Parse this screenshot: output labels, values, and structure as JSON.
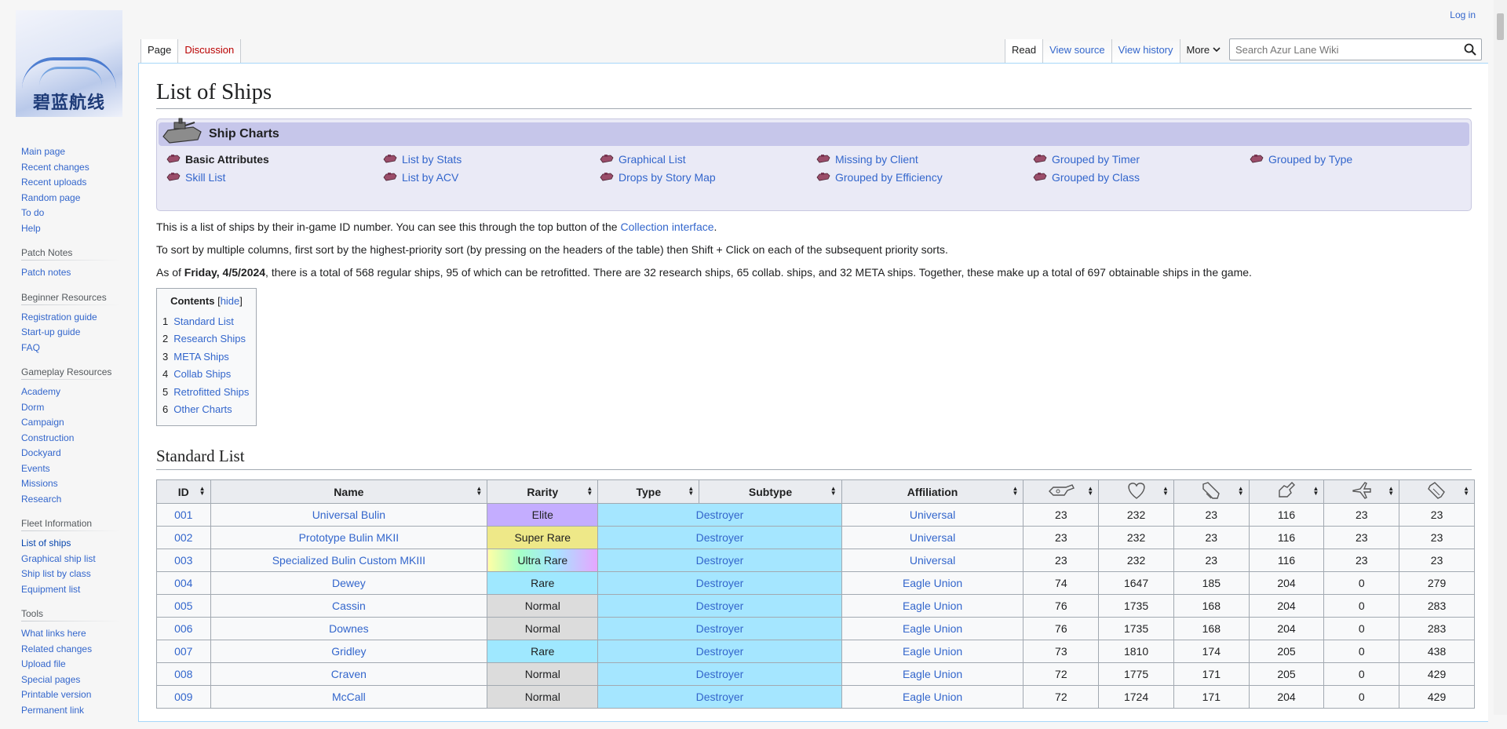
{
  "logo": {
    "text": "碧蓝航线"
  },
  "personal": {
    "login": "Log in"
  },
  "sidebar": {
    "nav": [
      "Main page",
      "Recent changes",
      "Recent uploads",
      "Random page",
      "To do",
      "Help"
    ],
    "sections": [
      {
        "heading": "Patch Notes",
        "items": [
          "Patch notes"
        ]
      },
      {
        "heading": "Beginner Resources",
        "items": [
          "Registration guide",
          "Start-up guide",
          "FAQ"
        ]
      },
      {
        "heading": "Gameplay Resources",
        "items": [
          "Academy",
          "Dorm",
          "Campaign",
          "Construction",
          "Dockyard",
          "Events",
          "Missions",
          "Research"
        ]
      },
      {
        "heading": "Fleet Information",
        "items": [
          "List of ships",
          "Graphical ship list",
          "Ship list by class",
          "Equipment list"
        ]
      },
      {
        "heading": "Tools",
        "items": [
          "What links here",
          "Related changes",
          "Upload file",
          "Special pages",
          "Printable version",
          "Permanent link"
        ]
      }
    ]
  },
  "tabs": {
    "page": "Page",
    "discussion": "Discussion",
    "read": "Read",
    "view_source": "View source",
    "view_history": "View history",
    "more": "More"
  },
  "search": {
    "placeholder": "Search Azur Lane Wiki"
  },
  "page": {
    "title": "List of Ships",
    "charts_title": "Ship Charts",
    "chart_links": [
      "Basic Attributes",
      "List by Stats",
      "Graphical List",
      "Missing by Client",
      "Grouped by Timer",
      "Grouped by Type",
      "Skill List",
      "List by ACV",
      "Drops by Story Map",
      "Grouped by Efficiency",
      "Grouped by Class"
    ],
    "p1_pre": "This is a list of ships by their in-game ID number. You can see this through the top button of the ",
    "p1_link": "Collection interface",
    "p1_post": ".",
    "p2": "To sort by multiple columns, first sort by the highest-priority sort (by pressing on the headers of the table) then Shift + Click on each of the subsequent priority sorts.",
    "p3_pre": "As of ",
    "p3_bold": "Friday, 4/5/2024",
    "p3_post": ", there is a total of 568 regular ships, 95 of which can be retrofitted. There are 32 research ships, 65 collab. ships, and 32 META ships. Together, these make up a total of 697 obtainable ships in the game.",
    "toc_title": "Contents",
    "toc_hide": "hide",
    "toc": [
      {
        "num": "1",
        "label": "Standard List"
      },
      {
        "num": "2",
        "label": "Research Ships"
      },
      {
        "num": "3",
        "label": "META Ships"
      },
      {
        "num": "4",
        "label": "Collab Ships"
      },
      {
        "num": "5",
        "label": "Retrofitted Ships"
      },
      {
        "num": "6",
        "label": "Other Charts"
      }
    ],
    "section_title": "Standard List"
  },
  "table": {
    "headers": [
      "ID",
      "Name",
      "Rarity",
      "Type",
      "Subtype",
      "Affiliation"
    ],
    "stat_icons": [
      "firepower-icon",
      "health-icon",
      "torpedo-icon",
      "anti-air-icon",
      "aviation-icon",
      "reload-icon"
    ],
    "rows": [
      {
        "id": "001",
        "name": "Universal Bulin",
        "rarity": "Elite",
        "rclass": "r-elite",
        "type": "Destroyer",
        "aff": "Universal",
        "s": [
          "23",
          "232",
          "23",
          "116",
          "23",
          "23"
        ]
      },
      {
        "id": "002",
        "name": "Prototype Bulin MKII",
        "rarity": "Super Rare",
        "rclass": "r-super",
        "type": "Destroyer",
        "aff": "Universal",
        "s": [
          "23",
          "232",
          "23",
          "116",
          "23",
          "23"
        ]
      },
      {
        "id": "003",
        "name": "Specialized Bulin Custom MKIII",
        "rarity": "Ultra Rare",
        "rclass": "r-ultra",
        "type": "Destroyer",
        "aff": "Universal",
        "s": [
          "23",
          "232",
          "23",
          "116",
          "23",
          "23"
        ]
      },
      {
        "id": "004",
        "name": "Dewey",
        "rarity": "Rare",
        "rclass": "r-rare",
        "type": "Destroyer",
        "aff": "Eagle Union",
        "s": [
          "74",
          "1647",
          "185",
          "204",
          "0",
          "279"
        ]
      },
      {
        "id": "005",
        "name": "Cassin",
        "rarity": "Normal",
        "rclass": "r-normal",
        "type": "Destroyer",
        "aff": "Eagle Union",
        "s": [
          "76",
          "1735",
          "168",
          "204",
          "0",
          "283"
        ]
      },
      {
        "id": "006",
        "name": "Downes",
        "rarity": "Normal",
        "rclass": "r-normal",
        "type": "Destroyer",
        "aff": "Eagle Union",
        "s": [
          "76",
          "1735",
          "168",
          "204",
          "0",
          "283"
        ]
      },
      {
        "id": "007",
        "name": "Gridley",
        "rarity": "Rare",
        "rclass": "r-rare",
        "type": "Destroyer",
        "aff": "Eagle Union",
        "s": [
          "73",
          "1810",
          "174",
          "205",
          "0",
          "438"
        ]
      },
      {
        "id": "008",
        "name": "Craven",
        "rarity": "Normal",
        "rclass": "r-normal",
        "type": "Destroyer",
        "aff": "Eagle Union",
        "s": [
          "72",
          "1775",
          "171",
          "205",
          "0",
          "429"
        ]
      },
      {
        "id": "009",
        "name": "McCall",
        "rarity": "Normal",
        "rclass": "r-normal",
        "type": "Destroyer",
        "aff": "Eagle Union",
        "s": [
          "72",
          "1724",
          "171",
          "204",
          "0",
          "429"
        ]
      }
    ]
  }
}
